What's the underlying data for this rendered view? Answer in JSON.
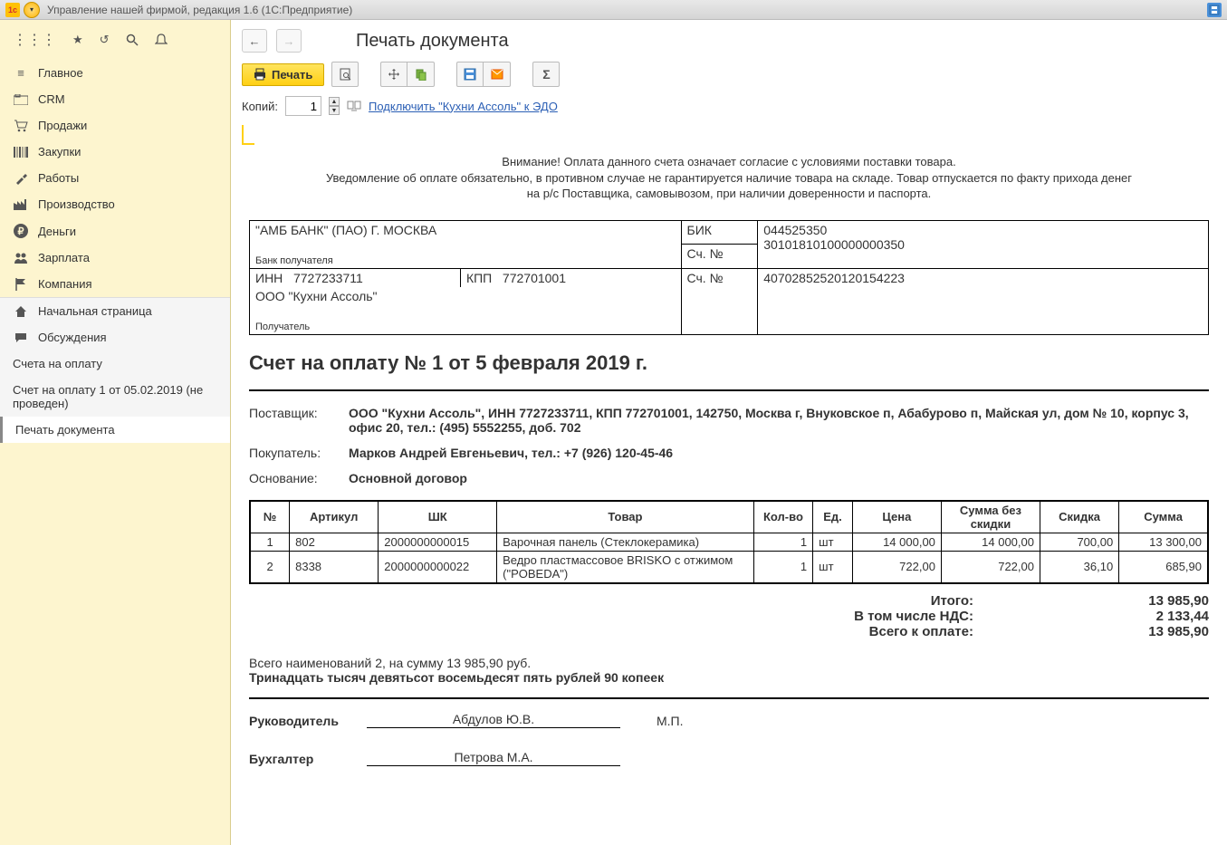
{
  "titlebar": {
    "title": "Управление нашей фирмой, редакция 1.6  (1С:Предприятие)"
  },
  "sidebar": {
    "main_items": [
      {
        "icon": "≡",
        "label": "Главное"
      },
      {
        "icon": "crm",
        "label": "CRM"
      },
      {
        "icon": "cart",
        "label": "Продажи"
      },
      {
        "icon": "barcode",
        "label": "Закупки"
      },
      {
        "icon": "tools",
        "label": "Работы"
      },
      {
        "icon": "factory",
        "label": "Производство"
      },
      {
        "icon": "ruble",
        "label": "Деньги"
      },
      {
        "icon": "people",
        "label": "Зарплата"
      },
      {
        "icon": "flag",
        "label": "Компания"
      }
    ],
    "lower_items": [
      {
        "icon": "home",
        "label": "Начальная страница"
      },
      {
        "icon": "chat",
        "label": "Обсуждения"
      }
    ],
    "sub_items": [
      {
        "label": "Счета на оплату",
        "active": false
      },
      {
        "label": "Счет на оплату 1 от 05.02.2019 (не проведен)",
        "active": false
      },
      {
        "label": "Печать документа",
        "active": true
      }
    ]
  },
  "main": {
    "title": "Печать документа",
    "print_label": "Печать",
    "copies_label": "Копий:",
    "copies_value": "1",
    "edo_link": "Подключить \"Кухни Ассоль\" к ЭДО"
  },
  "doc": {
    "warning_l1": "Внимание! Оплата данного счета означает согласие с условиями поставки товара.",
    "warning_l2": "Уведомление об оплате обязательно, в противном случае не гарантируется наличие товара на складе. Товар отпускается по факту прихода денег",
    "warning_l3": "на р/с Поставщика, самовывозом, при наличии доверенности и паспорта.",
    "bank": {
      "bank_name": "\"АМБ БАНК\" (ПАО) Г. МОСКВА",
      "bank_label": "Банк получателя",
      "bik_label": "БИК",
      "bik": "044525350",
      "acc1_label": "Сч. №",
      "acc1": "30101810100000000350",
      "inn_label": "ИНН",
      "inn": "7727233711",
      "kpp_label": "КПП",
      "kpp": "772701001",
      "acc2_label": "Сч. №",
      "acc2": "40702852520120154223",
      "org": "ООО \"Кухни Ассоль\"",
      "recipient_label": "Получатель"
    },
    "title": "Счет на оплату № 1 от 5 февраля 2019 г.",
    "supplier_label": "Поставщик:",
    "supplier": "ООО \"Кухни Ассоль\",  ИНН 7727233711,  КПП 772701001,  142750, Москва г, Внуковское п, Абабурово п, Майская ул, дом № 10, корпус 3, офис 20,  тел.: (495) 5552255, доб. 702",
    "buyer_label": "Покупатель:",
    "buyer": "Марков Андрей Евгеньевич,  тел.: +7 (926) 120-45-46",
    "basis_label": "Основание:",
    "basis": "Основной договор",
    "headers": {
      "n": "№",
      "art": "Артикул",
      "bc": "ШК",
      "good": "Товар",
      "qty": "Кол-во",
      "unit": "Ед.",
      "price": "Цена",
      "sum_nodisc": "Сумма без скидки",
      "disc": "Скидка",
      "sum": "Сумма"
    },
    "items": [
      {
        "n": "1",
        "art": "802",
        "bc": "2000000000015",
        "good": "Варочная панель (Стеклокерамика)",
        "qty": "1",
        "unit": "шт",
        "price": "14 000,00",
        "sum_nodisc": "14 000,00",
        "disc": "700,00",
        "sum": "13 300,00"
      },
      {
        "n": "2",
        "art": "8338",
        "bc": "2000000000022",
        "good": "Ведро пластмассовое BRISKO с отжимом (\"POBEDA\")",
        "qty": "1",
        "unit": "шт",
        "price": "722,00",
        "sum_nodisc": "722,00",
        "disc": "36,10",
        "sum": "685,90"
      }
    ],
    "totals": {
      "itogo_label": "Итого:",
      "itogo": "13 985,90",
      "nds_label": "В том числе НДС:",
      "nds": "2 133,44",
      "pay_label": "Всего к оплате:",
      "pay": "13 985,90"
    },
    "summary_line": "Всего наименований 2, на сумму 13 985,90 руб.",
    "amount_words": "Тринадцать тысяч девятьсот восемьдесят пять рублей 90 копеек",
    "sig": {
      "head_label": "Руководитель",
      "head_name": "Абдулов Ю.В.",
      "mp": "М.П.",
      "acc_label": "Бухгалтер",
      "acc_name": "Петрова М.А."
    }
  }
}
